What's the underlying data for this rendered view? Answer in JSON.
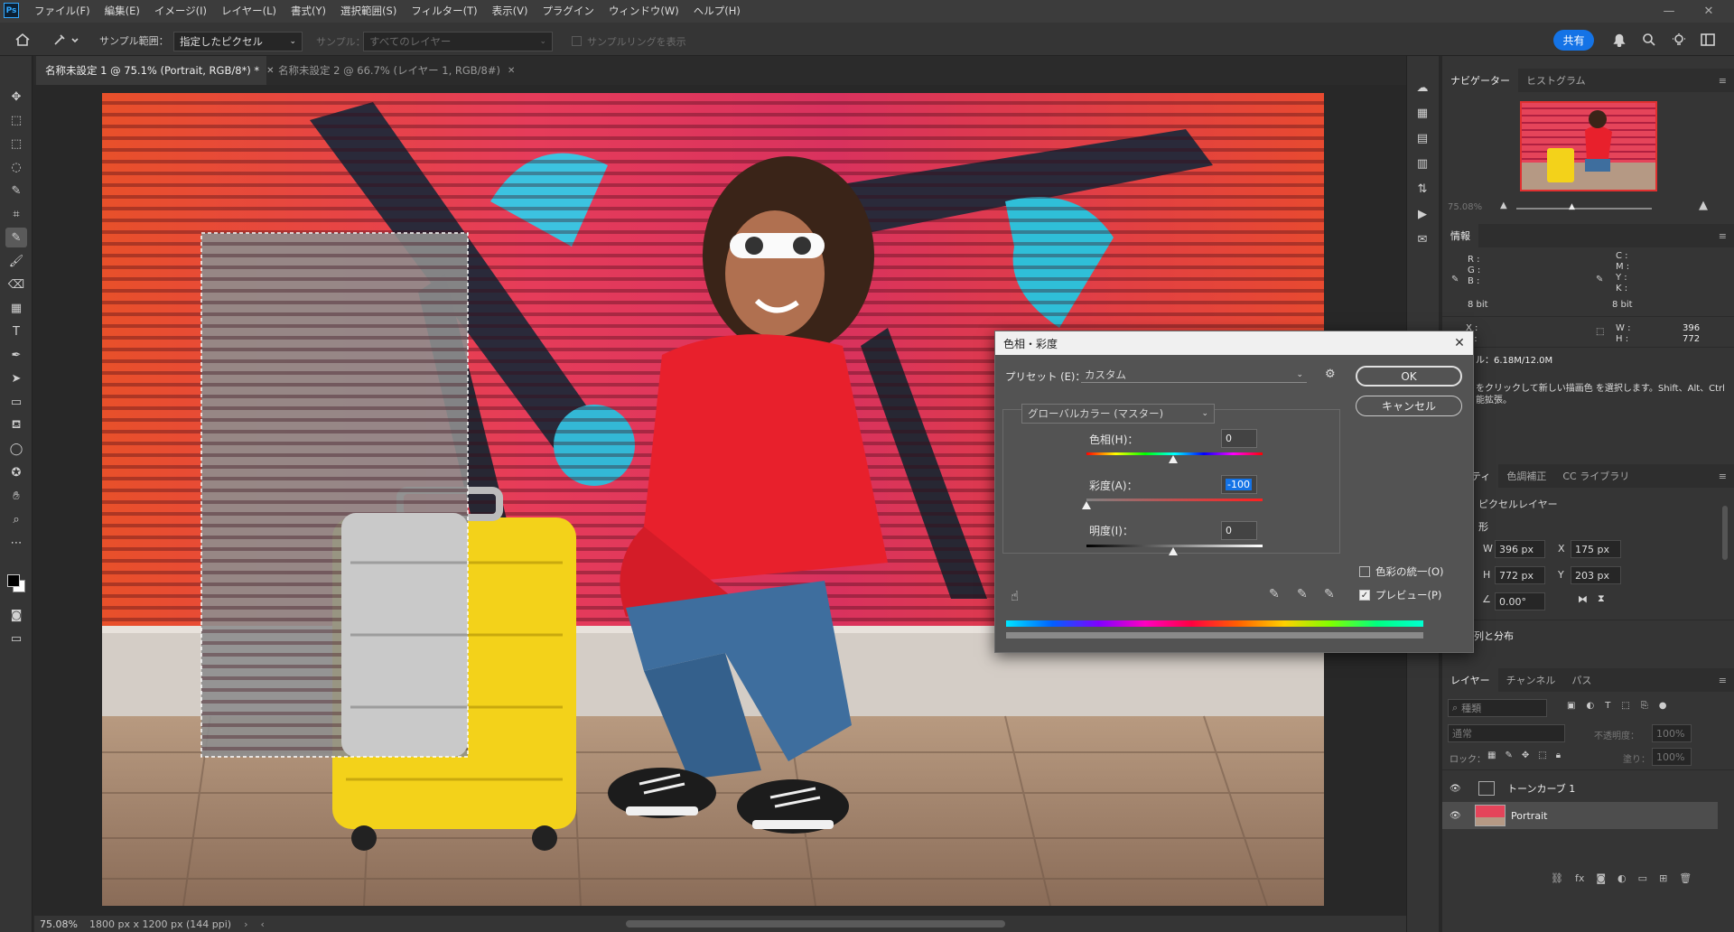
{
  "menubar": {
    "logo": "Ps",
    "items": [
      "ファイル(F)",
      "編集(E)",
      "イメージ(I)",
      "レイヤー(L)",
      "書式(Y)",
      "選択範囲(S)",
      "フィルター(T)",
      "表示(V)",
      "プラグイン",
      "ウィンドウ(W)",
      "ヘルプ(H)"
    ]
  },
  "optionsbar": {
    "sample_size_label": "サンプル範囲：",
    "sample_size_value": "指定したピクセル",
    "sample_label": "サンプル：",
    "sample_value": "すべてのレイヤー",
    "show_ring_label": "サンプルリングを表示",
    "share_label": "共有"
  },
  "tabs": [
    {
      "label": "名称未設定 1 @ 75.1% (Portrait, RGB/8*) *",
      "active": true
    },
    {
      "label": "名称未設定 2 @ 66.7% (レイヤー 1, RGB/8#)",
      "active": false
    }
  ],
  "status": {
    "zoom": "75.08%",
    "doc": "1800 px x 1200 px (144 ppi)"
  },
  "navigator": {
    "tabs": [
      "ナビゲーター",
      "ヒストグラム"
    ],
    "zoom": "75.08%"
  },
  "info": {
    "title": "情報",
    "rgb_labels": [
      "R :",
      "G :",
      "B :"
    ],
    "bit_left": "8 bit",
    "cmyk_labels": [
      "C :",
      "M :",
      "Y :",
      "K :"
    ],
    "bit_right": "8 bit",
    "xy_labels": [
      "X :",
      "Y :"
    ],
    "wh_labels": [
      "W :",
      "H :"
    ],
    "w_value": "396",
    "h_value": "772",
    "doc_size": "ル：6.18M/12.0M",
    "hint1": "をクリックして新しい描画色 を選択します。Shift、Alt、Ctrl",
    "hint2": "能拡張。"
  },
  "properties": {
    "tabs": [
      "ティ",
      "色調補正",
      "CC ライブラリ"
    ],
    "layer_kind": "ピクセルレイヤー",
    "transform_title": "形",
    "w_label": "W",
    "w_value": "396 px",
    "x_label": "X",
    "x_value": "175 px",
    "h_label": "H",
    "h_value": "772 px",
    "y_label": "Y",
    "y_value": "203 px",
    "angle_value": "0.00°",
    "align_title": "整列と分布"
  },
  "layers": {
    "tabs": [
      "レイヤー",
      "チャンネル",
      "パス"
    ],
    "filter_placeholder": "種類",
    "blend_mode": "通常",
    "opacity_label": "不透明度：",
    "opacity_value": "100%",
    "lock_label": "ロック：",
    "fill_label": "塗り：",
    "fill_value": "100%",
    "items": [
      {
        "name": "トーンカーブ 1",
        "selected": false
      },
      {
        "name": "Portrait",
        "selected": true
      }
    ]
  },
  "dialog": {
    "title": "色相・彩度",
    "preset_label": "プリセット (E)：",
    "preset_value": "カスタム",
    "ok_label": "OK",
    "cancel_label": "キャンセル",
    "channel_value": "グローバルカラー (マスター)",
    "hue_label": "色相(H)：",
    "hue_value": "0",
    "saturation_label": "彩度(A)：",
    "saturation_value": "-100",
    "lightness_label": "明度(I)：",
    "lightness_value": "0",
    "colorize_label": "色彩の統一(O)",
    "colorize_checked": false,
    "preview_label": "プレビュー(P)",
    "preview_checked": true
  }
}
